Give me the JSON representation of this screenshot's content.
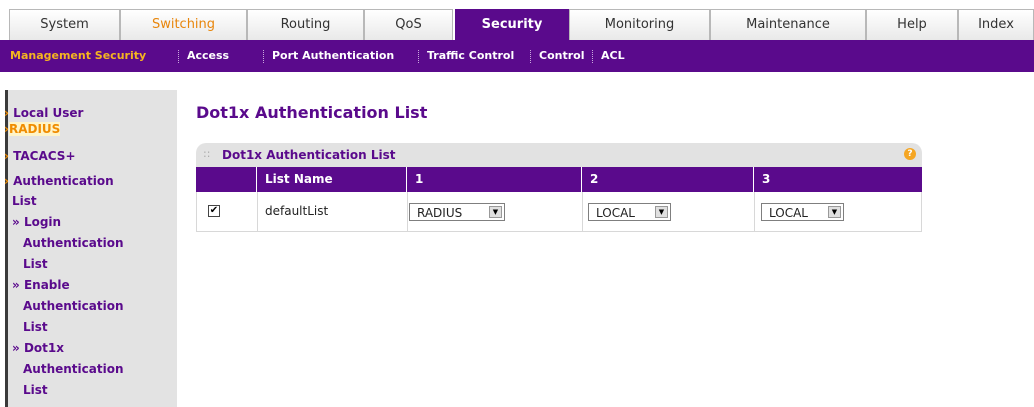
{
  "top_tabs": [
    "System",
    "Switching",
    "Routing",
    "QoS",
    "Security",
    "Monitoring",
    "Maintenance",
    "Help",
    "Index"
  ],
  "sub_tabs": [
    "Management Security",
    "Access",
    "Port Authentication",
    "Traffic Control",
    "Control",
    "ACL"
  ],
  "sidebar": {
    "local_user": "Local User",
    "radius": "RADIUS",
    "tacacs": "TACACS+",
    "auth_list_1": "Authentication",
    "auth_list_2": "List",
    "login_1": "Login",
    "login_2": "Authentication",
    "login_3": "List",
    "enable_1": "Enable",
    "enable_2": "Authentication",
    "enable_3": "List",
    "dot1x_1": "Dot1x",
    "dot1x_2": "Authentication",
    "dot1x_3": "List",
    "arrow_glyph": "›",
    "sub_glyph": "»"
  },
  "main": {
    "title": "Dot1x Authentication List",
    "panel_title": "Dot1x Authentication List",
    "help": "?",
    "columns": [
      "List Name",
      "1",
      "2",
      "3"
    ],
    "row": {
      "checked": true,
      "check_glyph": "✔",
      "list_name": "defaultList",
      "method_1": "RADIUS",
      "method_2": "LOCAL",
      "method_3": "LOCAL",
      "arrow": "▼"
    }
  }
}
